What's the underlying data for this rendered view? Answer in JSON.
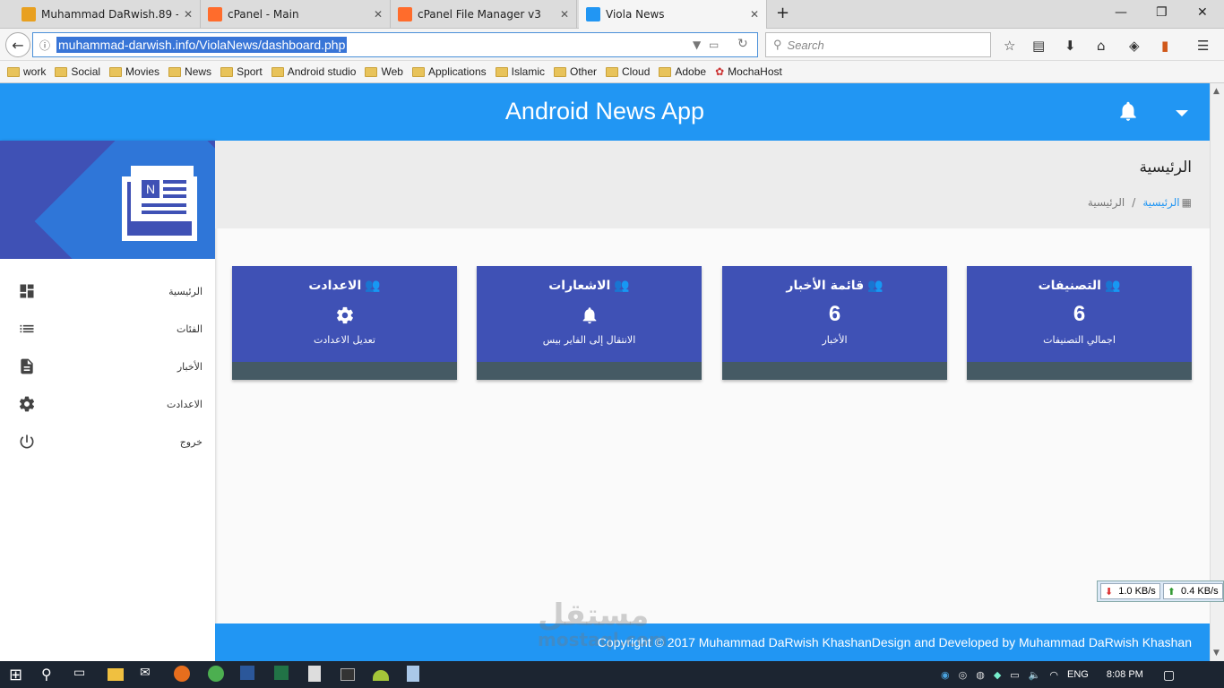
{
  "browser": {
    "tabs": [
      {
        "title": "Muhammad DaRwish.89 - ج",
        "close": "✕",
        "favicon_color": "#e8a020"
      },
      {
        "title": "cPanel - Main",
        "close": "✕",
        "favicon_color": "#ff6c2c"
      },
      {
        "title": "cPanel File Manager v3",
        "close": "✕",
        "favicon_color": "#ff6c2c"
      },
      {
        "title": "Viola News",
        "close": "✕",
        "favicon_color": "#2196f3"
      }
    ],
    "new_tab": "+",
    "window_controls": {
      "minimize": "—",
      "maximize": "❐",
      "close": "✕"
    },
    "url": "muhammad-darwish.info/ViolaNews/dashboard.php",
    "search_placeholder": "Search",
    "bookmarks": [
      "work",
      "Social",
      "Movies",
      "News",
      "Sport",
      "Android studio",
      "Web",
      "Applications",
      "Islamic",
      "Other",
      "Cloud",
      "Adobe",
      "MochaHost"
    ]
  },
  "app": {
    "title": "Android News App",
    "accent": "#2196f3",
    "card_color": "#3f51b5"
  },
  "sidebar": {
    "items": [
      {
        "label": "الرئيسية",
        "icon": "dashboard-icon"
      },
      {
        "label": "الفئات",
        "icon": "list-icon"
      },
      {
        "label": "الأخبار",
        "icon": "document-icon"
      },
      {
        "label": "الاعدادت",
        "icon": "gear-icon"
      },
      {
        "label": "خروج",
        "icon": "power-icon"
      }
    ]
  },
  "page": {
    "title": "الرئيسية",
    "breadcrumb": {
      "link": "الرئيسية",
      "separator": "/",
      "current": "الرئيسية"
    }
  },
  "cards": [
    {
      "title": "الاعدادت",
      "value": "",
      "subtitle": "تعديل الاعدادت",
      "icon": "gear-icon"
    },
    {
      "title": "الاشعارات",
      "value": "",
      "subtitle": "الانتقال إلى الفاير بيس",
      "icon": "bell-icon"
    },
    {
      "title": "قائمة الأخبار",
      "value": "6",
      "subtitle": "الأخبار",
      "icon": ""
    },
    {
      "title": "التصنيفات",
      "value": "6",
      "subtitle": "اجمالي التصنيفات",
      "icon": ""
    }
  ],
  "footer": {
    "text": "Copyright © 2017 Muhammad DaRwish KhashanDesign and Developed by Muhammad DaRwish Khashan"
  },
  "netmeter": {
    "down": "1.0 KB/s",
    "up": "0.4 KB/s"
  },
  "watermark": {
    "line1": "مستقل",
    "line2": "mostaql.com"
  },
  "taskbar": {
    "lang": "ENG",
    "time": "8:08 PM"
  }
}
